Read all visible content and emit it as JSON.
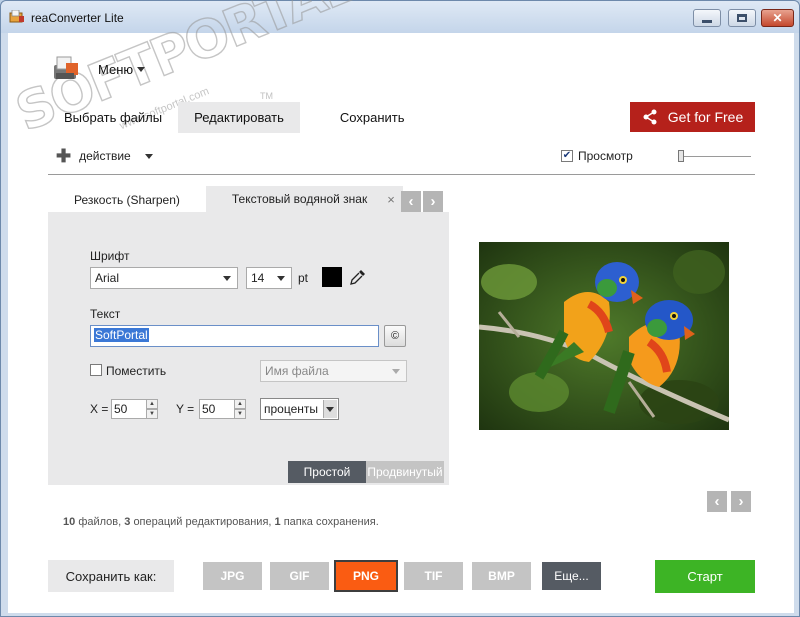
{
  "window": {
    "title": "reaConverter Lite"
  },
  "watermark": {
    "text": "SOFTPORTAL",
    "url": "www.softportal.com",
    "tm": "TM"
  },
  "menu": {
    "label": "Меню"
  },
  "main_tabs": [
    {
      "label": "Выбрать файлы"
    },
    {
      "label": "Редактировать",
      "active": true
    },
    {
      "label": "Сохранить"
    }
  ],
  "get_free": {
    "label": "Get for Free",
    "color": "#b5211b"
  },
  "action": {
    "label": "действие"
  },
  "preview": {
    "label": "Просмотр",
    "checked": true
  },
  "sub_tabs": [
    {
      "label": "Резкость (Sharpen)"
    },
    {
      "label": "Текстовый водяной знак",
      "active": true,
      "close": "×"
    }
  ],
  "panel": {
    "font_label": "Шрифт",
    "font_value": "Arial",
    "size_value": "14",
    "size_unit": "pt",
    "color": "#000000",
    "text_label": "Текст",
    "text_value": "SoftPortal",
    "copyright_button": "©",
    "place_label": "Поместить",
    "place_checked": false,
    "filename_placeholder": "Имя файла",
    "x_label": "X =",
    "x_value": "50",
    "y_label": "Y =",
    "y_value": "50",
    "unit_value": "проценты",
    "mode_simple": "Простой",
    "mode_advanced": "Продвинутый"
  },
  "stats": {
    "files_count": "10",
    "files_text": "файлов,",
    "ops_count": "3",
    "ops_text": "операций редактирования,",
    "folders_count": "1",
    "folders_text": "папка сохранения."
  },
  "bottom": {
    "save_as_label": "Сохранить как:",
    "formats": [
      "JPG",
      "GIF",
      "PNG",
      "TIF",
      "BMP"
    ],
    "selected_format": "PNG",
    "more_label": "Еще...",
    "start_label": "Старт",
    "start_color": "#3db425",
    "accent_color": "#fa5c12"
  }
}
